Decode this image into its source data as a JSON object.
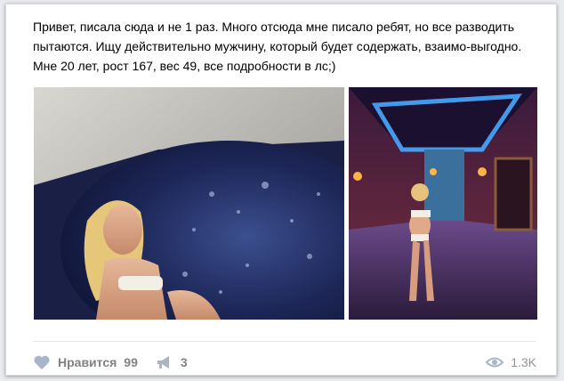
{
  "post": {
    "text": "Привет, писала сюда и не 1 раз. Много отсюда мне писало ребят, но все разводить пытаются. Ищу действительно мужчину, который будет содержать, взаимо-выгодно. Мне 20 лет, рост 167, вес 49, все подробности в лс;)"
  },
  "photos": [
    {
      "icon": "photo-jacuzzi"
    },
    {
      "icon": "photo-corridor"
    }
  ],
  "actions": {
    "like_label": "Нравится",
    "like_count": "99",
    "share_count": "3",
    "views_count": "1.3K"
  },
  "colors": {
    "accent_gray": "#828282",
    "post_bg": "#ffffff",
    "page_bg": "#e9ebee"
  }
}
